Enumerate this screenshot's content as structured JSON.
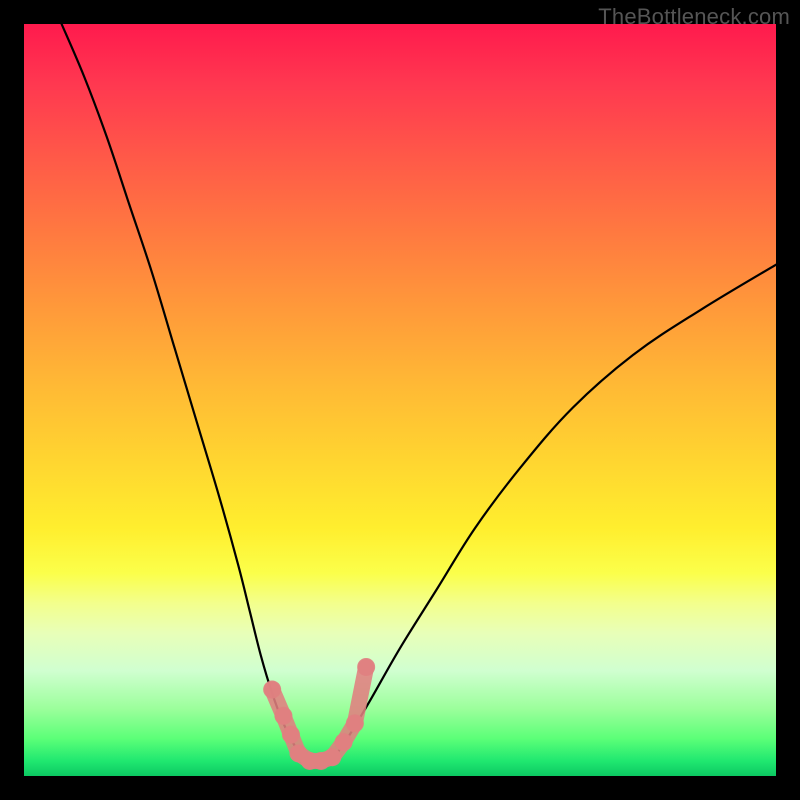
{
  "watermark": "TheBottleneck.com",
  "colors": {
    "background": "#000000",
    "curve": "#000000",
    "marker": "#e08080"
  },
  "chart_data": {
    "type": "line",
    "title": "",
    "xlabel": "",
    "ylabel": "",
    "xlim": [
      0,
      100
    ],
    "ylim": [
      0,
      100
    ],
    "curve_left": {
      "x": [
        5,
        8,
        11,
        14,
        17,
        20,
        23,
        26,
        28.5,
        30,
        31.5,
        33,
        34.5,
        36,
        37
      ],
      "y": [
        100,
        93,
        85,
        76,
        67,
        57,
        47,
        37,
        28,
        22,
        16,
        11,
        7,
        4,
        2.2
      ]
    },
    "curve_right": {
      "x": [
        41,
        43,
        46,
        50,
        55,
        60,
        66,
        73,
        81,
        90,
        100
      ],
      "y": [
        2.2,
        5,
        10,
        17,
        25,
        33,
        41,
        49,
        56,
        62,
        68
      ]
    },
    "flat_segment": {
      "x": [
        37,
        41
      ],
      "y": [
        2.0,
        2.0
      ]
    },
    "markers": [
      {
        "x": 33.0,
        "y": 11.5
      },
      {
        "x": 34.5,
        "y": 8.0
      },
      {
        "x": 35.5,
        "y": 5.5
      },
      {
        "x": 36.5,
        "y": 3.0
      },
      {
        "x": 38.0,
        "y": 2.0
      },
      {
        "x": 39.5,
        "y": 2.0
      },
      {
        "x": 41.0,
        "y": 2.5
      },
      {
        "x": 42.5,
        "y": 4.5
      },
      {
        "x": 44.0,
        "y": 7.0
      },
      {
        "x": 45.5,
        "y": 14.5
      }
    ]
  }
}
